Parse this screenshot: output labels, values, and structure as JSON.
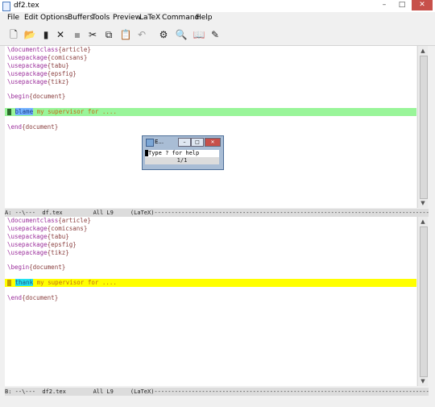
{
  "window": {
    "title": "df2.tex",
    "minimize": "–",
    "maximize": "□",
    "close": "✕"
  },
  "menu": [
    "File",
    "Edit",
    "Options",
    "Buffers",
    "Tools",
    "Preview",
    "LaTeX",
    "Command",
    "Help"
  ],
  "toolbar": {
    "icons": [
      "new-file-icon",
      "open-folder-icon",
      "save-icon",
      "close-icon",
      "save-disabled-icon",
      "cut-icon",
      "copy-icon",
      "paste-icon",
      "undo-icon",
      "latex-run-icon",
      "dvi-view-icon",
      "bibtex-icon",
      "spell-check-icon"
    ]
  },
  "top_pane": {
    "lines": [
      {
        "cmd": "\\documentclass",
        "arg": "{article}"
      },
      {
        "cmd": "\\usepackage",
        "arg": "{comicsans}"
      },
      {
        "cmd": "\\usepackage",
        "arg": "{tabu}"
      },
      {
        "cmd": "\\usepackage",
        "arg": "{epsfig}"
      },
      {
        "cmd": "\\usepackage",
        "arg": "{tikz}"
      },
      {
        "cmd": "\\begin",
        "arg": "{document}"
      },
      {
        "word": "blame",
        "rest": " my supervisor for ...."
      },
      {
        "cmd": "\\end",
        "arg": "{document}"
      }
    ],
    "modeline": "A: --\\---  df.tex         All L9     (LaTeX)--------------------------------------------------------------------------------------------"
  },
  "bottom_pane": {
    "lines": [
      {
        "cmd": "\\documentclass",
        "arg": "{article}"
      },
      {
        "cmd": "\\usepackage",
        "arg": "{comicsans}"
      },
      {
        "cmd": "\\usepackage",
        "arg": "{tabu}"
      },
      {
        "cmd": "\\usepackage",
        "arg": "{epsfig}"
      },
      {
        "cmd": "\\usepackage",
        "arg": "{tikz}"
      },
      {
        "cmd": "\\begin",
        "arg": "{document}"
      },
      {
        "word": "thank",
        "rest": " my supervisor for ...."
      },
      {
        "cmd": "\\end",
        "arg": "{document}"
      }
    ],
    "modeline": "B: --\\---  df2.tex        All L9     (LaTeX)--------------------------------------------------------------------------------------------"
  },
  "dialog": {
    "title": "E...",
    "prompt": "Type ? for help",
    "status": "1/1"
  },
  "colors": {
    "highlight_top": "#99f599",
    "highlight_bottom": "#ffff00",
    "word_top": "#74b3ff",
    "word_bottom": "#23e3ef"
  }
}
